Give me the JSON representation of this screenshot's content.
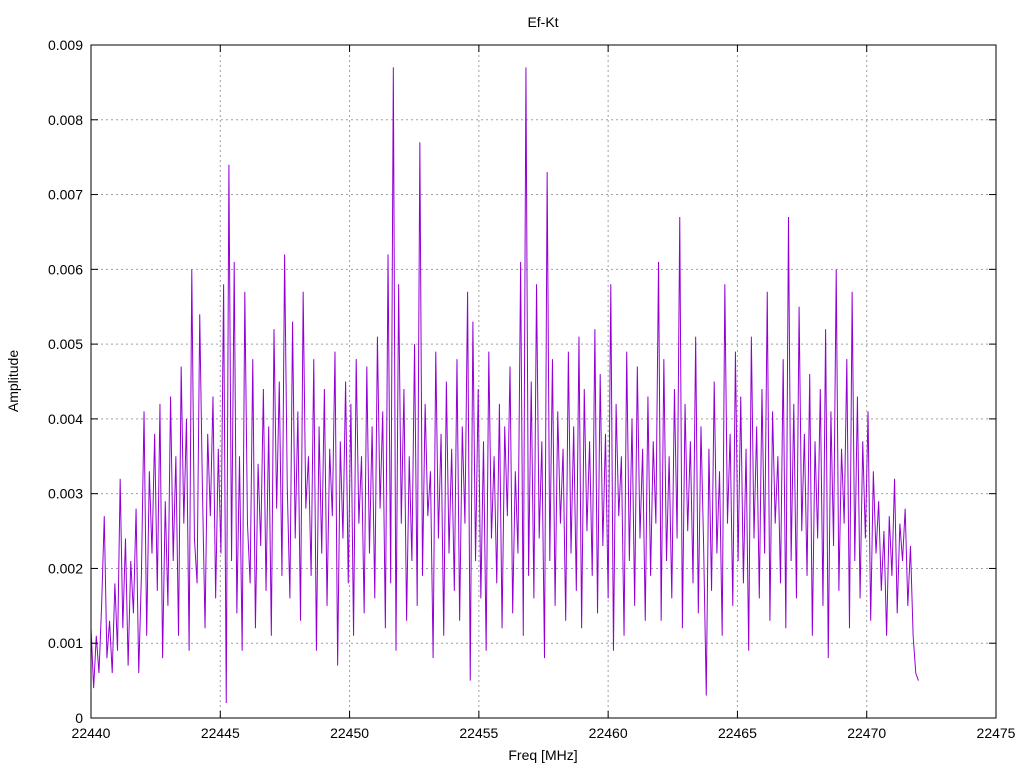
{
  "chart_data": {
    "type": "line",
    "title": "Ef-Kt",
    "xlabel": "Freq [MHz]",
    "ylabel": "Amplitude",
    "xlim": [
      22440,
      22475
    ],
    "ylim": [
      0,
      0.009
    ],
    "xticks": [
      22440,
      22445,
      22450,
      22455,
      22460,
      22465,
      22470,
      22475
    ],
    "xtick_labels": [
      "22440",
      "22445",
      "22450",
      "22455",
      "22460",
      "22465",
      "22470",
      "22475"
    ],
    "yticks": [
      0,
      0.001,
      0.002,
      0.003,
      0.004,
      0.005,
      0.006,
      0.007,
      0.008,
      0.009
    ],
    "ytick_labels": [
      "0",
      "0.001",
      "0.002",
      "0.003",
      "0.004",
      "0.005",
      "0.006",
      "0.007",
      "0.008",
      "0.009"
    ],
    "grid": true,
    "line_color": "#9400d3",
    "series": [
      {
        "x_start": 22440,
        "x_end": 22472,
        "values": [
          0.0012,
          0.0004,
          0.0011,
          0.0006,
          0.0015,
          0.0027,
          0.0008,
          0.0013,
          0.0006,
          0.0018,
          0.0009,
          0.0032,
          0.0012,
          0.0024,
          0.0007,
          0.0021,
          0.0014,
          0.0028,
          0.0006,
          0.0019,
          0.0041,
          0.0011,
          0.0033,
          0.0022,
          0.0038,
          0.0017,
          0.0042,
          0.0008,
          0.0029,
          0.0015,
          0.0043,
          0.0021,
          0.0035,
          0.0011,
          0.0047,
          0.0026,
          0.004,
          0.0009,
          0.006,
          0.0024,
          0.0018,
          0.0054,
          0.0031,
          0.0012,
          0.0038,
          0.0027,
          0.0043,
          0.0016,
          0.0036,
          0.0022,
          0.0058,
          0.0002,
          0.0074,
          0.0021,
          0.0061,
          0.0014,
          0.0035,
          0.0009,
          0.0057,
          0.0026,
          0.0018,
          0.0048,
          0.0012,
          0.0034,
          0.0023,
          0.0044,
          0.0017,
          0.0039,
          0.0011,
          0.0052,
          0.0028,
          0.0045,
          0.0019,
          0.0062,
          0.0031,
          0.0016,
          0.0053,
          0.0024,
          0.0041,
          0.0013,
          0.0057,
          0.0028,
          0.0035,
          0.0019,
          0.0048,
          0.0009,
          0.0039,
          0.0022,
          0.0044,
          0.0015,
          0.0036,
          0.0027,
          0.0049,
          0.0007,
          0.0037,
          0.0024,
          0.0045,
          0.0018,
          0.0042,
          0.0011,
          0.0048,
          0.0026,
          0.0035,
          0.0014,
          0.0047,
          0.0022,
          0.0039,
          0.0016,
          0.0051,
          0.0028,
          0.0041,
          0.0012,
          0.0062,
          0.0018,
          0.0087,
          0.0009,
          0.0058,
          0.0026,
          0.0044,
          0.0013,
          0.0035,
          0.0021,
          0.005,
          0.0015,
          0.0077,
          0.0019,
          0.0042,
          0.0027,
          0.0033,
          0.0008,
          0.0049,
          0.0024,
          0.0038,
          0.0011,
          0.0045,
          0.0022,
          0.0036,
          0.0017,
          0.0048,
          0.0013,
          0.0039,
          0.0026,
          0.0057,
          0.0005,
          0.0053,
          0.0021,
          0.0044,
          0.0016,
          0.0037,
          0.0009,
          0.0049,
          0.0024,
          0.0035,
          0.0018,
          0.0042,
          0.0012,
          0.0039,
          0.0027,
          0.0047,
          0.0014,
          0.0033,
          0.0022,
          0.0061,
          0.0011,
          0.0087,
          0.0019,
          0.0045,
          0.0016,
          0.0058,
          0.0024,
          0.0037,
          0.0008,
          0.0073,
          0.0021,
          0.0048,
          0.0015,
          0.0041,
          0.0026,
          0.0036,
          0.0013,
          0.0049,
          0.0022,
          0.0039,
          0.0017,
          0.0051,
          0.0012,
          0.0044,
          0.0025,
          0.0037,
          0.0019,
          0.0052,
          0.0014,
          0.0046,
          0.0023,
          0.0038,
          0.0016,
          0.0058,
          0.0009,
          0.0042,
          0.0027,
          0.0035,
          0.0011,
          0.0049,
          0.0021,
          0.004,
          0.0015,
          0.0047,
          0.0024,
          0.0036,
          0.0013,
          0.0043,
          0.0019,
          0.0037,
          0.0026,
          0.0061,
          0.0013,
          0.0048,
          0.0021,
          0.0035,
          0.0016,
          0.0044,
          0.0024,
          0.0067,
          0.0012,
          0.0042,
          0.0025,
          0.0037,
          0.0018,
          0.0051,
          0.0014,
          0.0039,
          0.0023,
          0.0003,
          0.0036,
          0.0017,
          0.0045,
          0.0022,
          0.0033,
          0.0011,
          0.0058,
          0.0026,
          0.0038,
          0.0015,
          0.0049,
          0.0021,
          0.0043,
          0.0018,
          0.0036,
          0.0009,
          0.0051,
          0.0024,
          0.0039,
          0.0016,
          0.0044,
          0.0022,
          0.0057,
          0.0013,
          0.0041,
          0.0026,
          0.0035,
          0.0018,
          0.0048,
          0.0012,
          0.0067,
          0.0021,
          0.0042,
          0.0016,
          0.0055,
          0.0025,
          0.0038,
          0.0019,
          0.0046,
          0.0011,
          0.0037,
          0.0024,
          0.0044,
          0.0015,
          0.0052,
          0.0008,
          0.0041,
          0.0023,
          0.006,
          0.0017,
          0.0036,
          0.0026,
          0.0048,
          0.0012,
          0.0057,
          0.0021,
          0.0043,
          0.0016,
          0.0037,
          0.0024,
          0.0041,
          0.0013,
          0.0033,
          0.0022,
          0.0029,
          0.0017,
          0.0025,
          0.0011,
          0.0027,
          0.0019,
          0.0032,
          0.0014,
          0.0026,
          0.0021,
          0.0028,
          0.0015,
          0.0023,
          0.0011,
          0.0006,
          0.0005
        ]
      }
    ]
  }
}
